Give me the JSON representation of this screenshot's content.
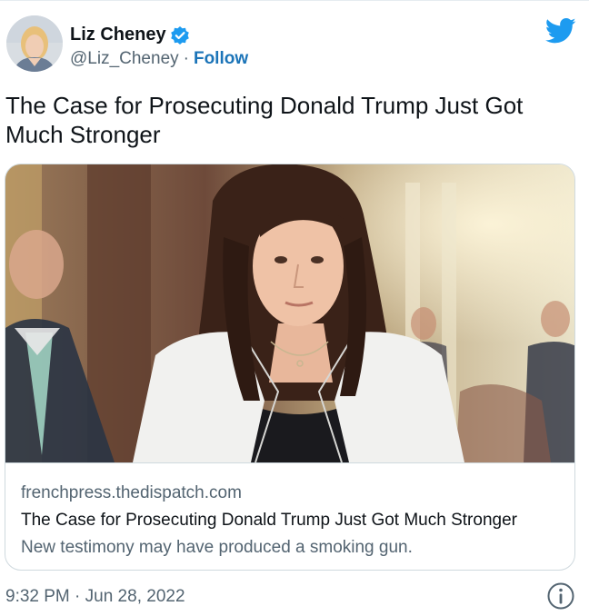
{
  "author": {
    "display_name": "Liz Cheney",
    "handle": "@Liz_Cheney",
    "separator": "·",
    "follow_label": "Follow",
    "verified": true
  },
  "icons": {
    "verified": "verified-badge-icon",
    "brand": "twitter-bird-icon",
    "info": "info-icon"
  },
  "tweet": {
    "text": "The Case for Prosecuting Donald Trump Just Got Much Stronger",
    "timestamp": "9:32 PM · Jun 28, 2022"
  },
  "card": {
    "domain": "frenchpress.thedispatch.com",
    "title": "The Case for Prosecuting Donald Trump Just Got Much Stronger",
    "description": "New testimony may have produced a smoking gun."
  },
  "colors": {
    "brand_blue": "#1d9bf0",
    "link": "#1b74b8",
    "secondary_text": "#536471",
    "border": "#cfd9de"
  }
}
